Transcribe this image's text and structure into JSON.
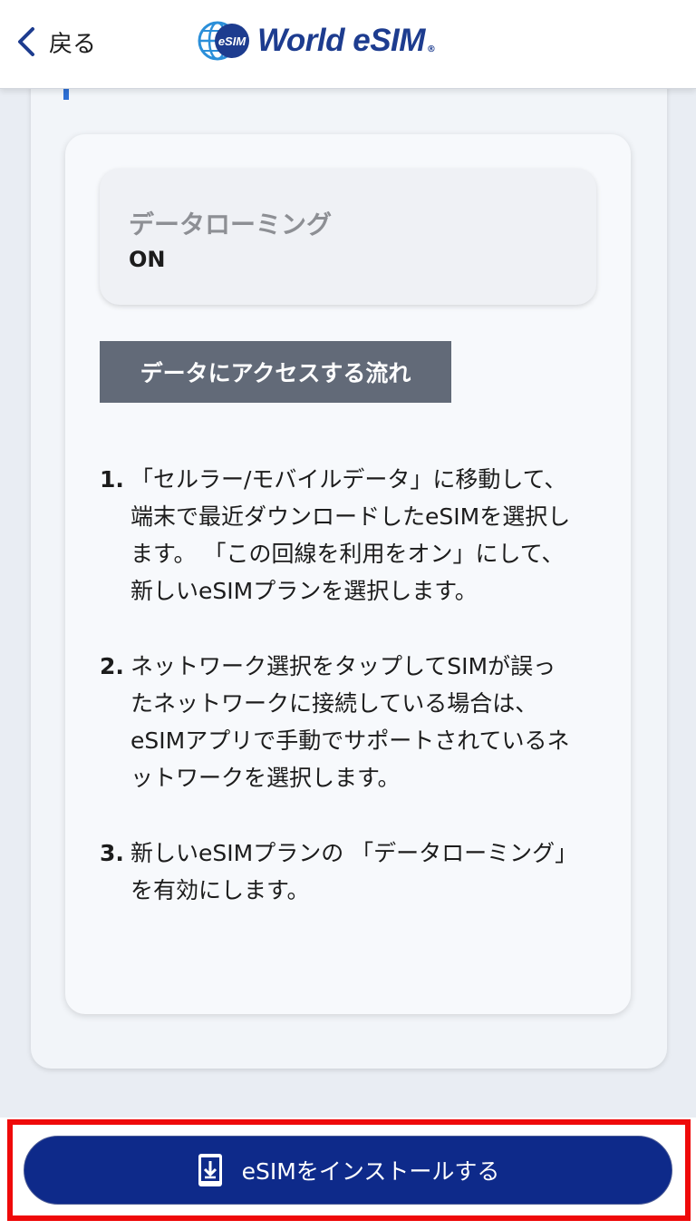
{
  "header": {
    "back_label": "戻る",
    "logo_badge": "eSIM",
    "logo_text": "World eSIM",
    "logo_reg": "®"
  },
  "card": {
    "setting": {
      "label": "データローミング",
      "value": "ON"
    },
    "flow_title": "データにアクセスする流れ",
    "steps": [
      {
        "num": "1.",
        "text": "「セルラー/モバイルデータ」に移動して、端末で最近ダウンロードしたeSIMを選択します。 「この回線を利用をオン」にして、新しいeSIMプランを選択します。"
      },
      {
        "num": "2.",
        "text": "ネットワーク選択をタップしてSIMが誤ったネットワークに接続している場合は、eSIMアプリで手動でサポートされているネットワークを選択します。"
      },
      {
        "num": "3.",
        "text": "新しいeSIMプランの 「データローミング」を有効にします。"
      }
    ]
  },
  "footer": {
    "install_label": "eSIMをインストールする"
  },
  "colors": {
    "brand_blue": "#0e2a8a",
    "highlight_red": "#ef0a0a",
    "badge_gray": "#626a78"
  },
  "icons": {
    "back": "chevron-left-icon",
    "logo": "globe-icon",
    "install": "phone-download-icon"
  }
}
